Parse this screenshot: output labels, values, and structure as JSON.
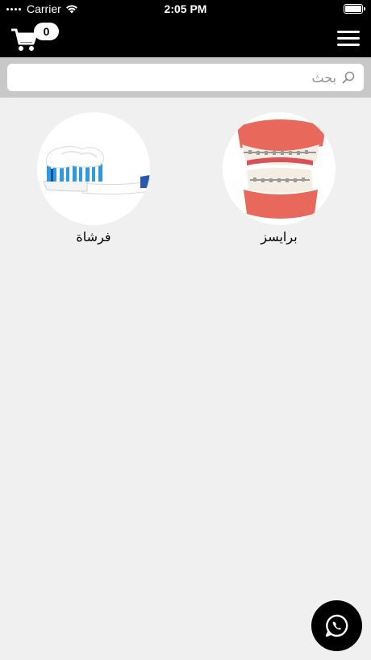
{
  "status_bar": {
    "carrier": "Carrier",
    "time": "2:05 PM"
  },
  "header": {
    "cart": {
      "icon": "cart-icon",
      "count": "0"
    },
    "menu": {
      "icon": "hamburger-menu-icon"
    }
  },
  "search": {
    "placeholder": "بحث",
    "value": "",
    "icon": "search-icon"
  },
  "categories": [
    {
      "label": "برايسز",
      "image": "braces-teeth-model"
    },
    {
      "label": "فرشاة",
      "image": "toothbrush-with-toothpaste"
    }
  ],
  "whatsapp": {
    "icon": "whatsapp-icon"
  }
}
